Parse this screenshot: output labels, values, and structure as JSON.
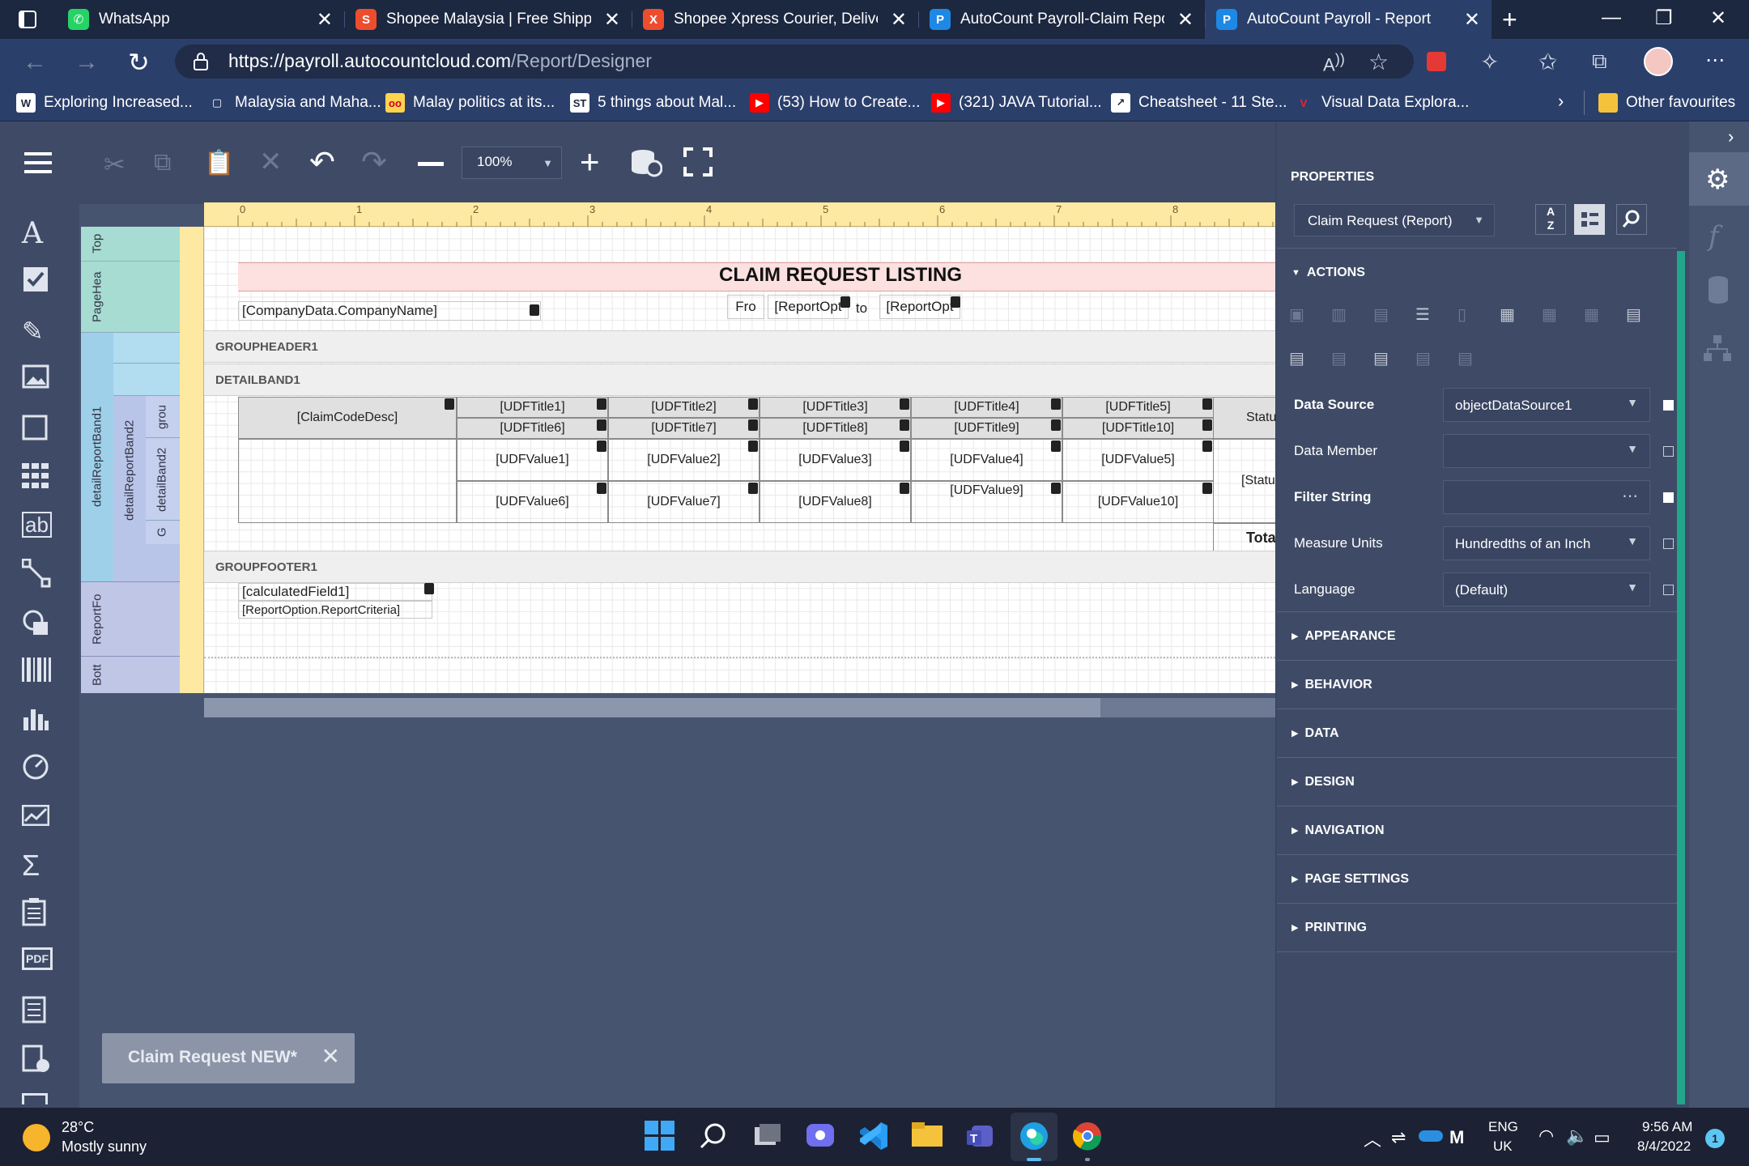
{
  "tabs": [
    {
      "title": "WhatsApp",
      "icon": "whatsapp-icon",
      "color": "#25d366",
      "glyph": "✆"
    },
    {
      "title": "Shopee Malaysia | Free Shipping",
      "icon": "shopee-icon",
      "color": "#ee4d2d",
      "glyph": "S"
    },
    {
      "title": "Shopee Xpress Courier, Delivery",
      "icon": "shopee-xpress-icon",
      "color": "#ee4d2d",
      "glyph": "X"
    },
    {
      "title": "AutoCount Payroll-Claim Report",
      "icon": "autocount-icon",
      "color": "#1e88e5",
      "glyph": "P"
    },
    {
      "title": "AutoCount Payroll - Report",
      "icon": "autocount-icon",
      "color": "#1e88e5",
      "glyph": "P"
    }
  ],
  "address": {
    "host": "https://payroll.autocountcloud.com",
    "path": "/Report/Designer"
  },
  "bookmarks": [
    {
      "label": "Exploring Increased...",
      "icon": "wiley-icon",
      "color": "#fff",
      "text_color": "#1c2740",
      "glyph": "W"
    },
    {
      "label": "Malaysia and Maha...",
      "icon": "document-icon",
      "color": "transparent",
      "text_color": "#fff",
      "glyph": "▢"
    },
    {
      "label": "Malay politics at its...",
      "icon": "site-icon",
      "color": "#ffd34d",
      "text_color": "#c02",
      "glyph": "oo"
    },
    {
      "label": "5 things about Mal...",
      "icon": "straits-times-icon",
      "color": "#fff",
      "text_color": "#1c2740",
      "glyph": "ST"
    },
    {
      "label": "(53) How to Create...",
      "icon": "youtube-icon",
      "color": "#ff0000",
      "text_color": "#fff",
      "glyph": "▶"
    },
    {
      "label": "(321) JAVA Tutorial...",
      "icon": "youtube-icon",
      "color": "#ff0000",
      "text_color": "#fff",
      "glyph": "▶"
    },
    {
      "label": "Cheatsheet - 11 Ste...",
      "icon": "chart-site-icon",
      "color": "#fff",
      "text_color": "#1c2740",
      "glyph": "↗"
    },
    {
      "label": "Visual Data Explora...",
      "icon": "harvard-icon",
      "color": "transparent",
      "text_color": "#e23",
      "glyph": "V"
    }
  ],
  "other_favourites": "Other favourites",
  "zoom": "100%",
  "ruler_numbers": [
    "0",
    "1",
    "2",
    "3",
    "4",
    "5",
    "6",
    "7",
    "8"
  ],
  "bands": {
    "top": "Top",
    "page_header": "PageHea",
    "detail_report_band1": "detailReportBand1",
    "detail_report_band2": "detailReportBand2",
    "group_short": "grou",
    "detail_band2": "detailBand2",
    "g": "G",
    "report_footer": "ReportFo",
    "bottom": "Bott"
  },
  "band_headers": {
    "group_header1": "GROUPHEADER1",
    "detail_band1": "DETAILBAND1",
    "group_footer1": "GROUPFOOTER1"
  },
  "report": {
    "title": "CLAIM REQUEST LISTING",
    "company": "[CompanyData.CompanyName]",
    "from_label": "Fro",
    "from_value": "[ReportOpt",
    "to_label": "to",
    "to_value": "[ReportOpt",
    "claim_code": "[ClaimCodeDesc]",
    "titles_row1": [
      "[UDFTitle1]",
      "[UDFTitle2]",
      "[UDFTitle3]",
      "[UDFTitle4]",
      "[UDFTitle5]"
    ],
    "titles_row2": [
      "[UDFTitle6]",
      "[UDFTitle7]",
      "[UDFTitle8]",
      "[UDFTitle9]",
      "[UDFTitle10]"
    ],
    "values_row1": [
      "[UDFValue1]",
      "[UDFValue2]",
      "[UDFValue3]",
      "[UDFValue4]",
      "[UDFValue5]"
    ],
    "values_row2": [
      "[UDFValue6]",
      "[UDFValue7]",
      "[UDFValue8]",
      "[UDFValue9]",
      "[UDFValue10]"
    ],
    "status_header": "Statu",
    "status_value": "[Statu",
    "total": "Tota",
    "calc_field": "[calculatedField1]",
    "criteria": "[ReportOption.ReportCriteria]"
  },
  "doc_tab": {
    "label": "Claim Request NEW*"
  },
  "properties": {
    "heading": "PROPERTIES",
    "selector": "Claim Request (Report)",
    "actions": "ACTIONS",
    "rows": [
      {
        "label": "Data Source",
        "value": "objectDataSource1",
        "bold": true,
        "type": "dropdown",
        "checked": true
      },
      {
        "label": "Data Member",
        "value": "",
        "bold": false,
        "type": "dropdown",
        "checked": false
      },
      {
        "label": "Filter String",
        "value": "",
        "bold": true,
        "type": "ellipsis",
        "checked": true
      },
      {
        "label": "Measure Units",
        "value": "Hundredths of an Inch",
        "bold": false,
        "type": "dropdown",
        "checked": false
      },
      {
        "label": "Language",
        "value": "(Default)",
        "bold": false,
        "type": "dropdown",
        "checked": false
      }
    ],
    "sections": [
      "APPEARANCE",
      "BEHAVIOR",
      "DATA",
      "DESIGN",
      "NAVIGATION",
      "PAGE SETTINGS",
      "PRINTING"
    ]
  },
  "weather": {
    "temp": "28°C",
    "desc": "Mostly sunny"
  },
  "tray": {
    "lang1": "ENG",
    "lang2": "UK",
    "time": "9:56 AM",
    "date": "8/4/2022",
    "badge": "1"
  },
  "colors": {
    "accent": "#21a58b",
    "title_band": "#fde0e0",
    "ruler": "#fde9a2"
  }
}
